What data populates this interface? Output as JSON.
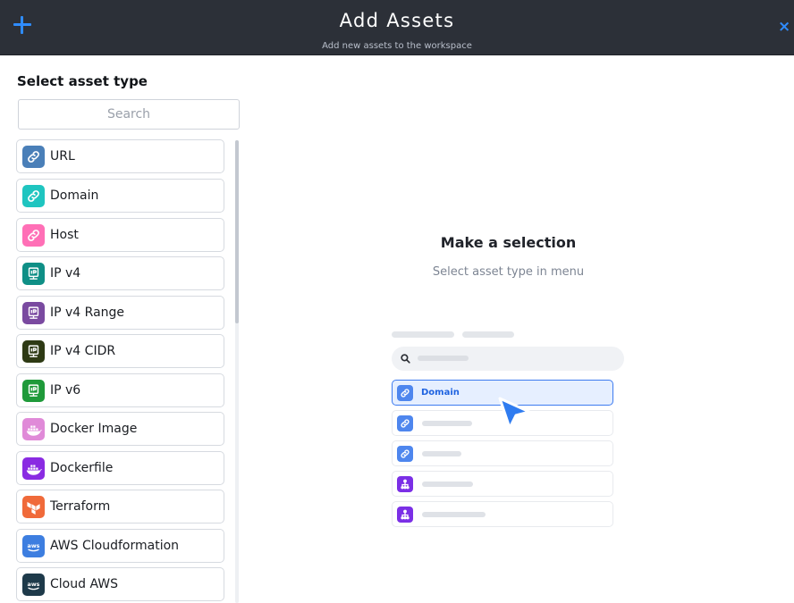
{
  "header": {
    "title": "Add Assets",
    "subtitle": "Add new assets to the workspace",
    "add_icon": "plus-icon",
    "close_icon": "close-icon",
    "close_label": "×",
    "accent_color": "#2f8cff",
    "background_color": "#2c3038"
  },
  "sidebar": {
    "title": "Select asset type",
    "search_placeholder": "Search",
    "items": [
      {
        "label": "URL",
        "icon": "link-icon",
        "color": "#4a7fb8"
      },
      {
        "label": "Domain",
        "icon": "link-icon",
        "color": "#1fc5c0"
      },
      {
        "label": "Host",
        "icon": "link-icon",
        "color": "#ff6fb6"
      },
      {
        "label": "IP v4",
        "icon": "ip-icon",
        "color": "#0f8f86"
      },
      {
        "label": "IP v4 Range",
        "icon": "ip-icon",
        "color": "#7a4aa0"
      },
      {
        "label": "IP v4 CIDR",
        "icon": "ip-icon",
        "color": "#2e3a14"
      },
      {
        "label": "IP v6",
        "icon": "ip-icon",
        "color": "#1f9a3a"
      },
      {
        "label": "Docker Image",
        "icon": "docker-icon",
        "color": "#e08ad8"
      },
      {
        "label": "Dockerfile",
        "icon": "docker-icon",
        "color": "#8a2be2"
      },
      {
        "label": "Terraform",
        "icon": "terraform-icon",
        "color": "#f06a3a"
      },
      {
        "label": "AWS Cloudformation",
        "icon": "aws-icon",
        "color": "#3d7ee0"
      },
      {
        "label": "Cloud AWS",
        "icon": "aws-icon",
        "color": "#1e3a4a"
      }
    ]
  },
  "main": {
    "title": "Make a selection",
    "subtitle": "Select asset type in menu",
    "illustration": {
      "active_label": "Domain",
      "active_color": "#3d7bf0",
      "row_icons": [
        "link-icon",
        "link-icon",
        "link-icon",
        "hierarchy-icon",
        "hierarchy-icon"
      ]
    }
  }
}
